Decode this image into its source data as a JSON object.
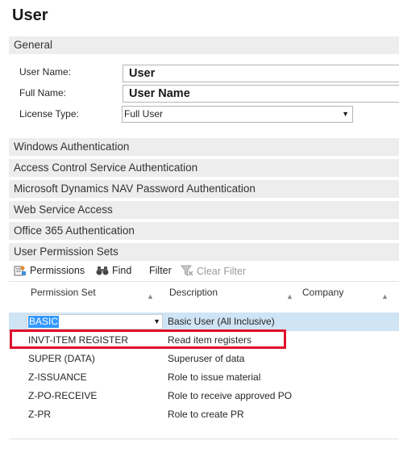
{
  "page": {
    "title": "User"
  },
  "general": {
    "header": "General",
    "user_name_label": "User Name:",
    "user_name_value": "User",
    "full_name_label": "Full Name:",
    "full_name_value": "User Name",
    "license_type_label": "License Type:",
    "license_type_value": "Full User"
  },
  "sections": {
    "windows_auth": "Windows Authentication",
    "acs_auth": "Access Control Service Authentication",
    "nav_password_auth": "Microsoft Dynamics NAV Password Authentication",
    "web_service_access": "Web Service Access",
    "office365_auth": "Office 365 Authentication",
    "permission_sets": "User Permission Sets"
  },
  "toolbar": {
    "permissions_label": "Permissions",
    "find_label": "Find",
    "filter_label": "Filter",
    "clear_filter_label": "Clear Filter"
  },
  "grid": {
    "columns": [
      "Permission Set",
      "Description",
      "Company"
    ],
    "rows": [
      {
        "permission_set": "BASIC",
        "description": "Basic User (All Inclusive)"
      },
      {
        "permission_set": "INVT-ITEM REGISTER",
        "description": "Read item registers"
      },
      {
        "permission_set": "SUPER (DATA)",
        "description": "Superuser of data"
      },
      {
        "permission_set": "Z-ISSUANCE",
        "description": "Role to issue material"
      },
      {
        "permission_set": "Z-PO-RECEIVE",
        "description": "Role to receive approved PO"
      },
      {
        "permission_set": "Z-PR",
        "description": "Role to create PR"
      }
    ]
  },
  "colors": {
    "selected_row": "#cfe4f5",
    "selection_highlight": "#3399ff",
    "annotation_box": "#e0102a",
    "section_bg": "#ededed"
  }
}
